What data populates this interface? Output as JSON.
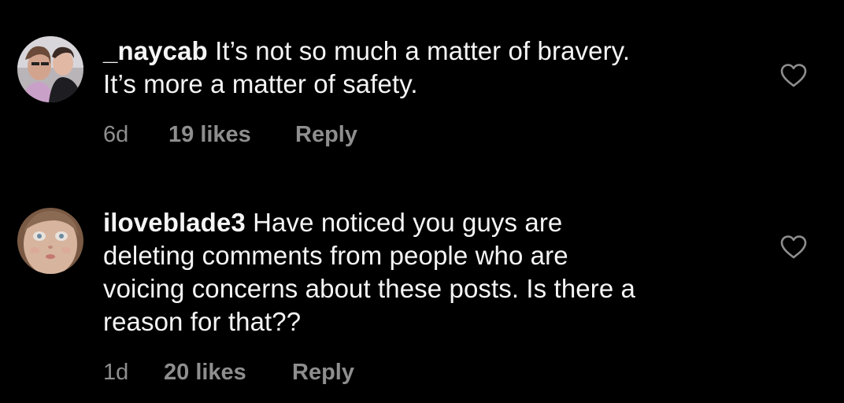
{
  "comments": [
    {
      "username": "_naycab",
      "text": "It’s not so much a matter of bravery.",
      "text_line2": "It’s more a matter of safety.",
      "time": "6d",
      "likes": "19 likes",
      "reply_label": "Reply",
      "avatar_icon": "profile-photo-two-people",
      "like_icon": "heart-outline-icon"
    },
    {
      "username": "iloveblade3",
      "text": "Have noticed you guys are",
      "text_line2": "deleting comments from people who are",
      "text_line3": "voicing concerns about these posts. Is there a",
      "text_line4": "reason for that??",
      "time": "1d",
      "likes": "20 likes",
      "reply_label": "Reply",
      "avatar_icon": "profile-photo-doll-face",
      "like_icon": "heart-outline-icon"
    }
  ],
  "colors": {
    "background": "#000000",
    "primary_text": "#f5f5f5",
    "secondary_text": "#8e8e8e"
  }
}
